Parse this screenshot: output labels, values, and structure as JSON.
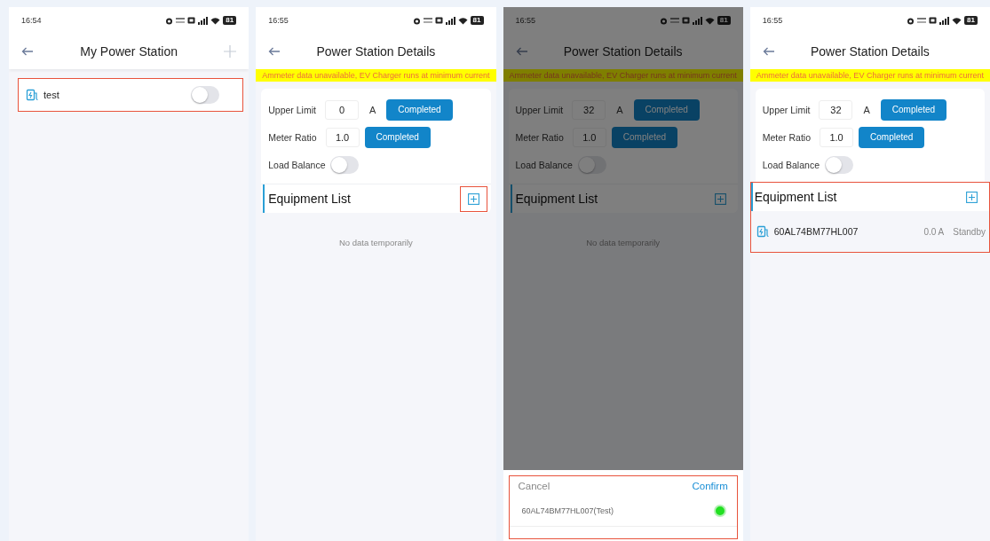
{
  "screens": [
    {
      "kind": "list",
      "dimmed": false,
      "status": {
        "time": "16:54",
        "battery": "81"
      },
      "header": {
        "title": "My Power Station",
        "add": true
      },
      "stations": [
        {
          "name": "test",
          "on": false,
          "highlighted": true
        }
      ]
    },
    {
      "kind": "details",
      "dimmed": false,
      "status": {
        "time": "16:55",
        "battery": "81"
      },
      "header": {
        "title": "Power Station Details",
        "add": false
      },
      "warning": "Ammeter data unavailable, EV Charger runs at minimum current",
      "settings": {
        "upper_limit": {
          "label": "Upper Limit",
          "value": "0",
          "unit": "A",
          "button": "Completed"
        },
        "meter_ratio": {
          "label": "Meter Ratio",
          "value": "1.0",
          "button": "Completed"
        },
        "load_balance": {
          "label": "Load Balance",
          "on": false
        }
      },
      "equipment": {
        "title": "Equipment List",
        "add_highlighted": true,
        "highlighted": false,
        "empty": "No data temporarily"
      }
    },
    {
      "kind": "details",
      "dimmed": true,
      "status": {
        "time": "16:55",
        "battery": "81"
      },
      "header": {
        "title": "Power Station Details",
        "add": false
      },
      "warning": "Ammeter data unavailable, EV Charger runs at minimum current",
      "settings": {
        "upper_limit": {
          "label": "Upper Limit",
          "value": "32",
          "unit": "A",
          "button": "Completed"
        },
        "meter_ratio": {
          "label": "Meter Ratio",
          "value": "1.0",
          "button": "Completed"
        },
        "load_balance": {
          "label": "Load Balance",
          "on": false
        }
      },
      "equipment": {
        "title": "Equipment List",
        "add_highlighted": false,
        "highlighted": false,
        "empty": "No data temporarily"
      },
      "sheet": {
        "cancel": "Cancel",
        "confirm": "Confirm",
        "highlighted": true,
        "options": [
          {
            "label": "60AL74BM77HL007(Test)",
            "selected": true
          }
        ]
      }
    },
    {
      "kind": "details",
      "dimmed": false,
      "status": {
        "time": "16:55",
        "battery": "81"
      },
      "header": {
        "title": "Power Station Details",
        "add": false
      },
      "warning": "Ammeter data unavailable, EV Charger runs at minimum current",
      "settings": {
        "upper_limit": {
          "label": "Upper Limit",
          "value": "32",
          "unit": "A",
          "button": "Completed"
        },
        "meter_ratio": {
          "label": "Meter Ratio",
          "value": "1.0",
          "button": "Completed"
        },
        "load_balance": {
          "label": "Load Balance",
          "on": false
        }
      },
      "equipment": {
        "title": "Equipment List",
        "add_highlighted": false,
        "highlighted": true,
        "items": [
          {
            "id": "60AL74BM77HL007",
            "current": "0.0 A",
            "status": "Standby"
          }
        ]
      }
    }
  ]
}
